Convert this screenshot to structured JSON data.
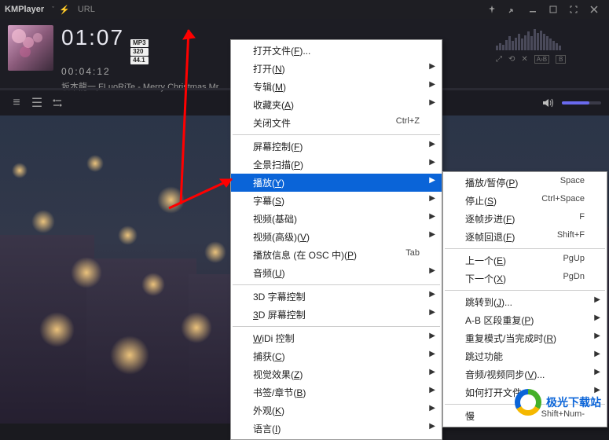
{
  "titlebar": {
    "app_name": "KMPlayer",
    "url_label": "URL"
  },
  "player": {
    "big_time": "01:07",
    "fmt1": "MP3",
    "fmt2": "320",
    "fmt3": "44.1",
    "elapsed": "00:04:12",
    "track": "坂本龍一,FLuoRiTe - Merry Christmas Mr. ..."
  },
  "vis_ctrls": {
    "a": "⤢",
    "b": "⟲",
    "c": "✕",
    "d": "A›B",
    "e": "B"
  },
  "toolbar": {
    "t1": "≡",
    "t2": "☰",
    "t3": "⚙"
  },
  "menu1": [
    {
      "type": "item",
      "label": "打开文件(<u>F</u>)..."
    },
    {
      "type": "item",
      "label": "打开(<u>N</u>)",
      "sub": true
    },
    {
      "type": "item",
      "label": "专辑(<u>M</u>)",
      "sub": true
    },
    {
      "type": "item",
      "label": "收藏夹(<u>A</u>)",
      "sub": true
    },
    {
      "type": "item",
      "label": "关闭文件",
      "shortcut": "Ctrl+Z"
    },
    {
      "type": "sep"
    },
    {
      "type": "item",
      "label": "屏幕控制(<u>F</u>)",
      "sub": true
    },
    {
      "type": "item",
      "label": "全景扫描(<u>P</u>)",
      "sub": true
    },
    {
      "type": "item",
      "label": "播放(<u>Y</u>)",
      "sub": true,
      "hl": true
    },
    {
      "type": "item",
      "label": "字幕(<u>S</u>)",
      "sub": true
    },
    {
      "type": "item",
      "label": "视频(基础)",
      "sub": true
    },
    {
      "type": "item",
      "label": "视频(高级)(<u>V</u>)",
      "sub": true
    },
    {
      "type": "item",
      "label": "播放信息 (在 OSC 中)(<u>P</u>)",
      "shortcut": "Tab"
    },
    {
      "type": "item",
      "label": "音频(<u>U</u>)",
      "sub": true
    },
    {
      "type": "sep"
    },
    {
      "type": "item",
      "label": "3D 字幕控制",
      "sub": true
    },
    {
      "type": "item",
      "label": "<u>3</u>D 屏幕控制",
      "sub": true
    },
    {
      "type": "sep"
    },
    {
      "type": "item",
      "label": "<u>W</u>iDi 控制",
      "sub": true
    },
    {
      "type": "item",
      "label": "捕获(<u>C</u>)",
      "sub": true
    },
    {
      "type": "item",
      "label": "视觉效果(<u>Z</u>)",
      "sub": true
    },
    {
      "type": "item",
      "label": "书签/章节(<u>B</u>)",
      "sub": true
    },
    {
      "type": "item",
      "label": "外观(<u>K</u>)",
      "sub": true
    },
    {
      "type": "item",
      "label": "语言(<u>I</u>)",
      "sub": true
    }
  ],
  "menu2": [
    {
      "type": "item",
      "label": "播放/暂停(<u>P</u>)",
      "shortcut": "Space"
    },
    {
      "type": "item",
      "label": "停止(<u>S</u>)",
      "shortcut": "Ctrl+Space"
    },
    {
      "type": "item",
      "label": "逐帧步进(<u>F</u>)",
      "shortcut": "F"
    },
    {
      "type": "item",
      "label": "逐帧回退(<u>F</u>)",
      "shortcut": "Shift+F"
    },
    {
      "type": "sep"
    },
    {
      "type": "item",
      "label": "上一个(<u>E</u>)",
      "shortcut": "PgUp"
    },
    {
      "type": "item",
      "label": "下一个(<u>X</u>)",
      "shortcut": "PgDn"
    },
    {
      "type": "sep"
    },
    {
      "type": "item",
      "label": "跳转到(<u>J</u>)...",
      "sub": true
    },
    {
      "type": "item",
      "label": "A-B 区段重复(<u>P</u>)",
      "sub": true
    },
    {
      "type": "item",
      "label": "重复模式/当完成时(<u>R</u>)",
      "sub": true
    },
    {
      "type": "item",
      "label": "跳过功能",
      "sub": true
    },
    {
      "type": "item",
      "label": "音频/视频同步(<u>V</u>)...",
      "sub": true
    },
    {
      "type": "item",
      "label": "如何打开文件",
      "sub": true
    },
    {
      "type": "sep"
    },
    {
      "type": "item",
      "label": "慢",
      "shortcut": "Shift+Num-"
    }
  ],
  "watermark": {
    "text": "极光下载站"
  }
}
